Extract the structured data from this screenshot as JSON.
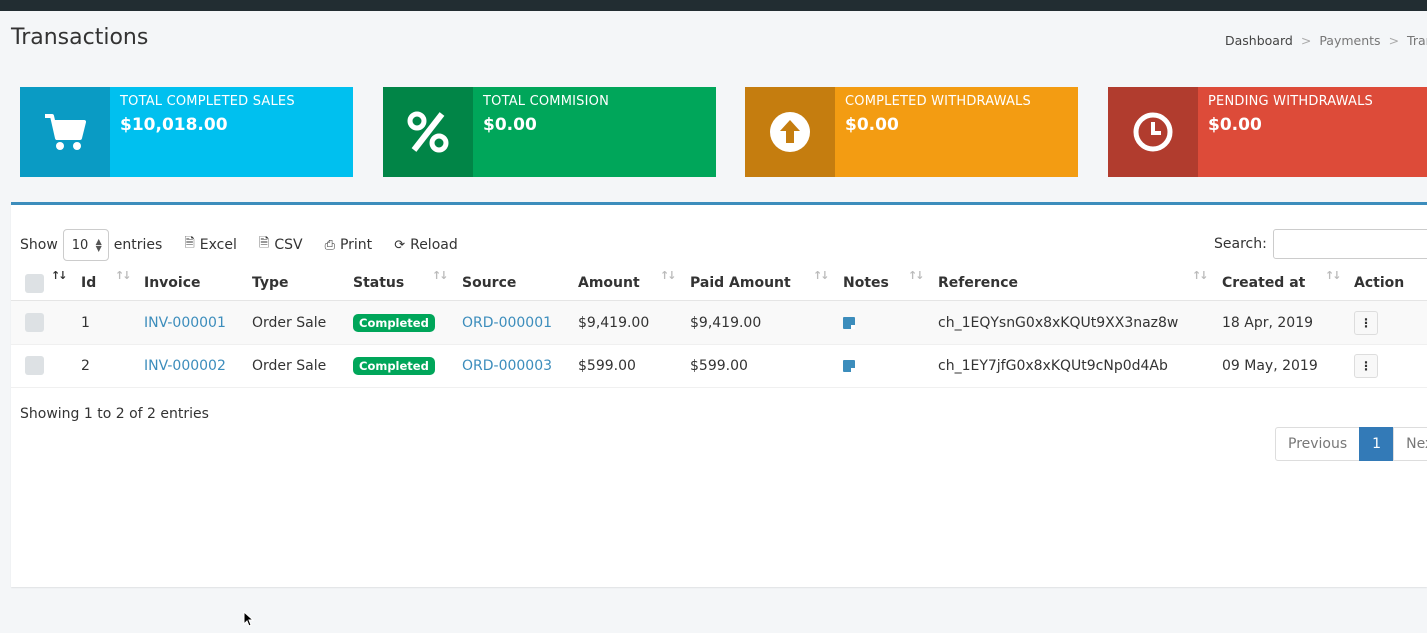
{
  "page": {
    "title": "Transactions"
  },
  "breadcrumb": [
    "Dashboard",
    "Payments",
    "Transact"
  ],
  "summary_boxes": [
    {
      "label": "TOTAL COMPLETED SALES",
      "value": "$10,018.00",
      "icon": "shopping-cart-icon",
      "color": "#00c0ef"
    },
    {
      "label": "TOTAL COMMISION",
      "value": "$0.00",
      "icon": "percent-icon",
      "color": "#00a65a"
    },
    {
      "label": "COMPLETED WITHDRAWALS",
      "value": "$0.00",
      "icon": "arrow-circle-up-icon",
      "color": "#f39c12"
    },
    {
      "label": "PENDING WITHDRAWALS",
      "value": "$0.00",
      "icon": "clock-icon",
      "color": "#dd4b39"
    }
  ],
  "toolbar": {
    "show_label": "Show",
    "entries_value": "10",
    "entries_label": "entries",
    "excel": "Excel",
    "csv": "CSV",
    "print": "Print",
    "reload": "Reload",
    "search_label": "Search:",
    "search_value": ""
  },
  "table": {
    "columns": [
      "Id",
      "Invoice",
      "Type",
      "Status",
      "Source",
      "Amount",
      "Paid Amount",
      "Notes",
      "Reference",
      "Created at",
      "Action"
    ],
    "rows": [
      {
        "id": "1",
        "invoice": "INV-000001",
        "type": "Order Sale",
        "status": "Completed",
        "source": "ORD-000001",
        "amount": "$9,419.00",
        "paid_amount": "$9,419.00",
        "reference": "ch_1EQYsnG0x8xKQUt9XX3naz8w",
        "created_at": "18 Apr, 2019"
      },
      {
        "id": "2",
        "invoice": "INV-000002",
        "type": "Order Sale",
        "status": "Completed",
        "source": "ORD-000003",
        "amount": "$599.00",
        "paid_amount": "$599.00",
        "reference": "ch_1EY7jfG0x8xKQUt9cNp0d4Ab",
        "created_at": "09 May, 2019"
      }
    ]
  },
  "footer": {
    "info": "Showing 1 to 2 of 2 entries",
    "pagination": {
      "previous": "Previous",
      "current": "1",
      "next": "Next"
    }
  },
  "colors": {
    "accent": "#3c8dbc",
    "status_completed": "#00a65a"
  }
}
